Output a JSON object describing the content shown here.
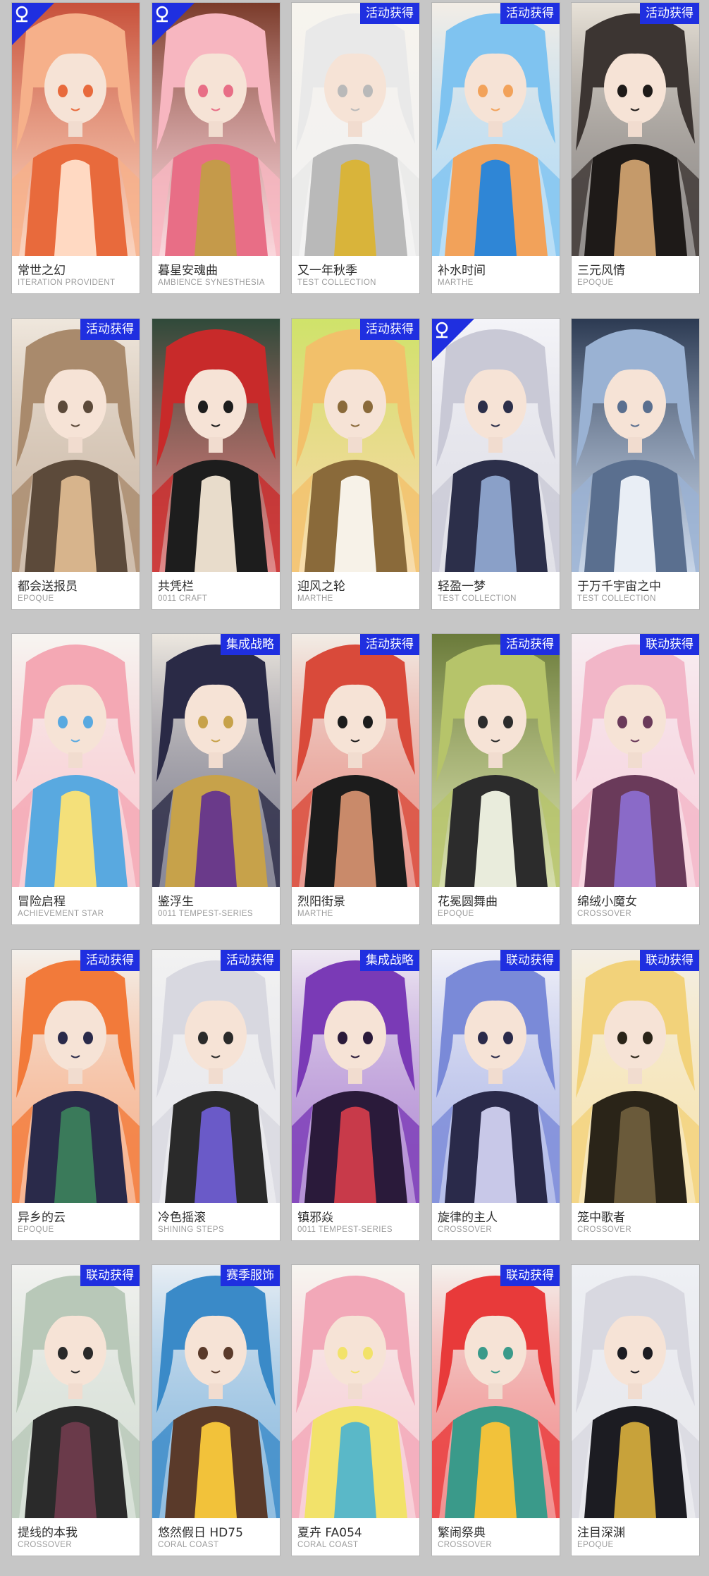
{
  "colors": {
    "background": "#c6c6c6",
    "card": "#ffffff",
    "badge": "#1f2fe0",
    "name_text": "#2e2e2e",
    "series_text": "#9c9c9c"
  },
  "skins": [
    {
      "name": "常世之幻",
      "series": "ITERATION PROVIDENT",
      "badge": "",
      "corner_icon": "premium-icon",
      "palette": [
        "#f6b08a",
        "#e86a3c",
        "#ffd9c2",
        "#c7503a"
      ]
    },
    {
      "name": "暮星安魂曲",
      "series": "AMBIENCE SYNESTHESIA",
      "badge": "",
      "corner_icon": "premium-icon",
      "palette": [
        "#f7b6c0",
        "#e86e86",
        "#c59a4a",
        "#7a3b2a"
      ]
    },
    {
      "name": "又一年秋季",
      "series": "TEST COLLECTION",
      "badge": "活动获得",
      "corner_icon": "",
      "palette": [
        "#e9e9e9",
        "#b9b9b9",
        "#d9b43a",
        "#f7f4ee"
      ]
    },
    {
      "name": "补水时间",
      "series": "MARTHE",
      "badge": "活动获得",
      "corner_icon": "",
      "palette": [
        "#7fc3f0",
        "#f2a25a",
        "#2f86d6",
        "#f3ede6"
      ]
    },
    {
      "name": "三元风情",
      "series": "EPOQUE",
      "badge": "活动获得",
      "corner_icon": "",
      "palette": [
        "#3c3532",
        "#1e1a18",
        "#c59a6a",
        "#e8e2d8"
      ]
    },
    {
      "name": "都会送报员",
      "series": "EPOQUE",
      "badge": "活动获得",
      "corner_icon": "",
      "palette": [
        "#a98a6c",
        "#5c4a3a",
        "#d7b48c",
        "#efe7dd"
      ]
    },
    {
      "name": "共凭栏",
      "series": "0011 CRAFT",
      "badge": "",
      "corner_icon": "",
      "palette": [
        "#c82a2a",
        "#1d1d1d",
        "#e8dccb",
        "#2f4a3a"
      ]
    },
    {
      "name": "迎风之轮",
      "series": "MARTHE",
      "badge": "活动获得",
      "corner_icon": "",
      "palette": [
        "#f2c06a",
        "#8a6a3a",
        "#f7f2e8",
        "#cfe36a"
      ]
    },
    {
      "name": "轻盈一梦",
      "series": "TEST COLLECTION",
      "badge": "",
      "corner_icon": "premium-icon",
      "palette": [
        "#c9c9d6",
        "#2c2f4a",
        "#8aa0c8",
        "#f4f4f8"
      ]
    },
    {
      "name": "于万千宇宙之中",
      "series": "TEST COLLECTION",
      "badge": "",
      "corner_icon": "",
      "palette": [
        "#9ab2d3",
        "#5a6f8f",
        "#e9eef5",
        "#2c3a52"
      ]
    },
    {
      "name": "冒险启程",
      "series": "ACHIEVEMENT STAR",
      "badge": "",
      "corner_icon": "",
      "palette": [
        "#f4a8b4",
        "#59a9e0",
        "#f4e07a",
        "#f7f5f1"
      ]
    },
    {
      "name": "鉴浮生",
      "series": "0011 TEMPEST-SERIES",
      "badge": "集成战略",
      "corner_icon": "",
      "palette": [
        "#2a2a46",
        "#c7a24a",
        "#6a3a8a",
        "#ede8e0"
      ]
    },
    {
      "name": "烈阳街景",
      "series": "MARTHE",
      "badge": "活动获得",
      "corner_icon": "",
      "palette": [
        "#d94a3a",
        "#1c1c1c",
        "#c98a6a",
        "#f2ede6"
      ]
    },
    {
      "name": "花冕圆舞曲",
      "series": "EPOQUE",
      "badge": "活动获得",
      "corner_icon": "",
      "palette": [
        "#b6c46a",
        "#2c2c2c",
        "#e9ecdc",
        "#6a7a3a"
      ]
    },
    {
      "name": "绵绒小魔女",
      "series": "CROSSOVER",
      "badge": "联动获得",
      "corner_icon": "",
      "palette": [
        "#f2b6c8",
        "#6a3a5a",
        "#8a6ac8",
        "#f7eef2"
      ]
    },
    {
      "name": "异乡的云",
      "series": "EPOQUE",
      "badge": "活动获得",
      "corner_icon": "",
      "palette": [
        "#f27a3a",
        "#2a2a4a",
        "#3a7a5a",
        "#f4f1ec"
      ]
    },
    {
      "name": "冷色摇滚",
      "series": "SHINING STEPS",
      "badge": "活动获得",
      "corner_icon": "",
      "palette": [
        "#d8d8e0",
        "#2a2a2a",
        "#6a5ac8",
        "#f2f2f2"
      ]
    },
    {
      "name": "镇邪焱",
      "series": "0011 TEMPEST-SERIES",
      "badge": "集成战略",
      "corner_icon": "",
      "palette": [
        "#7a3ab6",
        "#2a1a3a",
        "#c83a4a",
        "#efe9f2"
      ]
    },
    {
      "name": "旋律的主人",
      "series": "CROSSOVER",
      "badge": "联动获得",
      "corner_icon": "",
      "palette": [
        "#7a8ad8",
        "#2a2a4a",
        "#c8c8e8",
        "#f2f2f8"
      ]
    },
    {
      "name": "笼中歌者",
      "series": "CROSSOVER",
      "badge": "联动获得",
      "corner_icon": "",
      "palette": [
        "#f2d27a",
        "#2a2418",
        "#6a5a3a",
        "#f4efe6"
      ]
    },
    {
      "name": "提线的本我",
      "series": "CROSSOVER",
      "badge": "联动获得",
      "corner_icon": "",
      "palette": [
        "#b8c8b8",
        "#2a2a2a",
        "#6a3a4a",
        "#f2f2f0"
      ]
    },
    {
      "name": "悠然假日 HD75",
      "series": "CORAL COAST",
      "badge": "赛季服饰",
      "corner_icon": "",
      "palette": [
        "#3a8ac8",
        "#5a3a2a",
        "#f2c23a",
        "#e8eef4"
      ]
    },
    {
      "name": "夏卉 FA054",
      "series": "CORAL COAST",
      "badge": "",
      "corner_icon": "",
      "palette": [
        "#f2a8b8",
        "#f2e26a",
        "#5ab8c8",
        "#f7f5f0"
      ]
    },
    {
      "name": "繁闹祭典",
      "series": "CROSSOVER",
      "badge": "联动获得",
      "corner_icon": "",
      "palette": [
        "#e83a3a",
        "#3a9a8a",
        "#f2c23a",
        "#f5f2ee"
      ]
    },
    {
      "name": "注目深渊",
      "series": "EPOQUE",
      "badge": "",
      "corner_icon": "",
      "palette": [
        "#d8d8e0",
        "#1c1c22",
        "#c8a23a",
        "#eef0f4"
      ]
    }
  ]
}
